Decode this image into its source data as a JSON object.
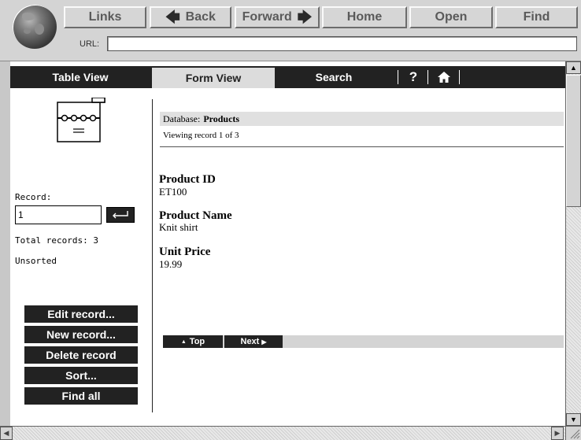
{
  "browser": {
    "toolbar": {
      "links_label": "Links",
      "back_label": "Back",
      "forward_label": "Forward",
      "home_label": "Home",
      "open_label": "Open",
      "find_label": "Find"
    },
    "url": {
      "label": "URL:",
      "value": ""
    }
  },
  "app": {
    "nav": {
      "tabs": [
        {
          "label": "Table View",
          "active": false
        },
        {
          "label": "Form View",
          "active": true
        },
        {
          "label": "Search",
          "active": false
        }
      ],
      "help_label": "?",
      "home_icon": "home-icon"
    },
    "sidebar": {
      "database_icon": "database-file-icon",
      "record_label": "Record:",
      "record_value": "1",
      "go_icon": "return-arrow-icon",
      "total_records": "Total records: 3",
      "sort_status": "Unsorted",
      "actions": [
        "Edit record...",
        "New record...",
        "Delete record",
        "Sort...",
        "Find all"
      ]
    },
    "main": {
      "database_label": "Database:",
      "database_name": "Products",
      "viewing_text": "Viewing record 1 of 3",
      "fields": [
        {
          "label": "Product ID",
          "value": "ET100"
        },
        {
          "label": "Product Name",
          "value": "Knit shirt"
        },
        {
          "label": "Unit Price",
          "value": "19.99"
        }
      ],
      "pager": {
        "top_label": "Top",
        "next_label": "Next"
      }
    }
  },
  "colors": {
    "nav_bg": "#222222",
    "active_tab_bg": "#dcdcdc",
    "header_bar_bg": "#e0e0e0",
    "chrome_bg": "#d4d4d4"
  }
}
